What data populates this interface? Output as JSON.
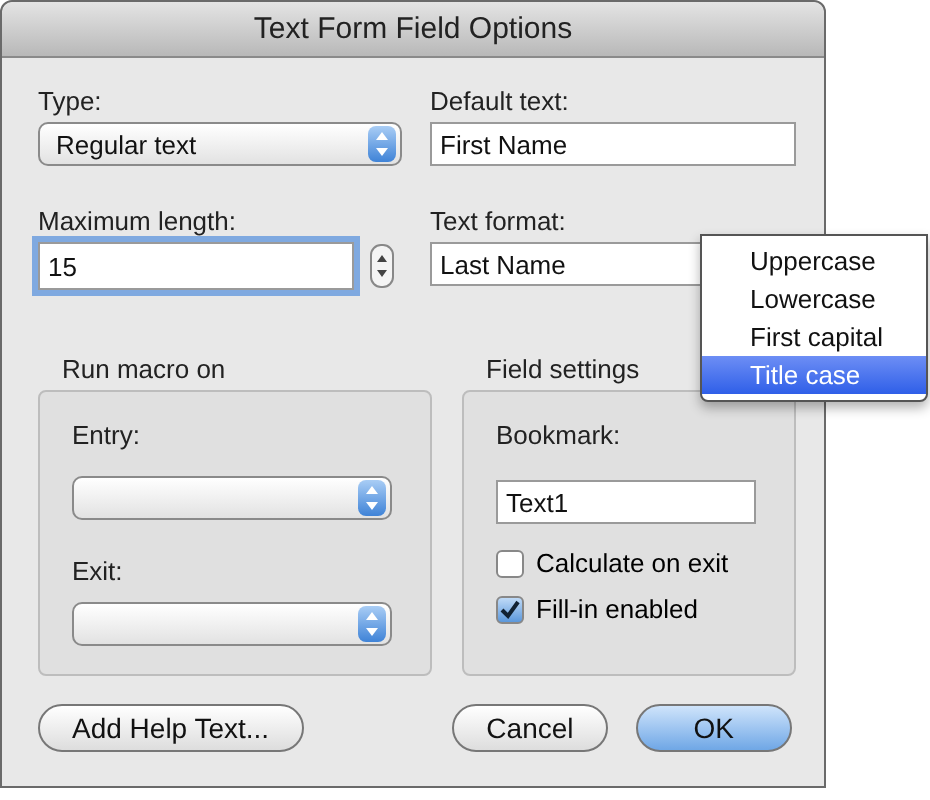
{
  "window": {
    "title": "Text Form Field Options"
  },
  "type": {
    "label": "Type:",
    "value": "Regular text"
  },
  "default_text": {
    "label": "Default text:",
    "value": "First Name"
  },
  "maximum_length": {
    "label": "Maximum length:",
    "value": "15",
    "focused": true
  },
  "text_format": {
    "label": "Text format:",
    "value": "Last Name",
    "menu": [
      {
        "label": "Uppercase",
        "selected": false
      },
      {
        "label": "Lowercase",
        "selected": false
      },
      {
        "label": "First capital",
        "selected": false
      },
      {
        "label": "Title case",
        "selected": true
      }
    ]
  },
  "run_macro_on": {
    "title": "Run macro on",
    "entry": {
      "label": "Entry:"
    },
    "exit": {
      "label": "Exit:"
    }
  },
  "field_settings": {
    "title": "Field settings",
    "bookmark": {
      "label": "Bookmark:",
      "value": "Text1"
    },
    "options": [
      {
        "label": "Calculate on exit",
        "checked": false
      },
      {
        "label": "Fill-in enabled",
        "checked": true
      }
    ]
  },
  "buttons": [
    {
      "label": "Add Help Text...",
      "kind": "plain"
    },
    {
      "label": "Cancel",
      "kind": "plain"
    },
    {
      "label": "OK",
      "kind": "default"
    }
  ]
}
